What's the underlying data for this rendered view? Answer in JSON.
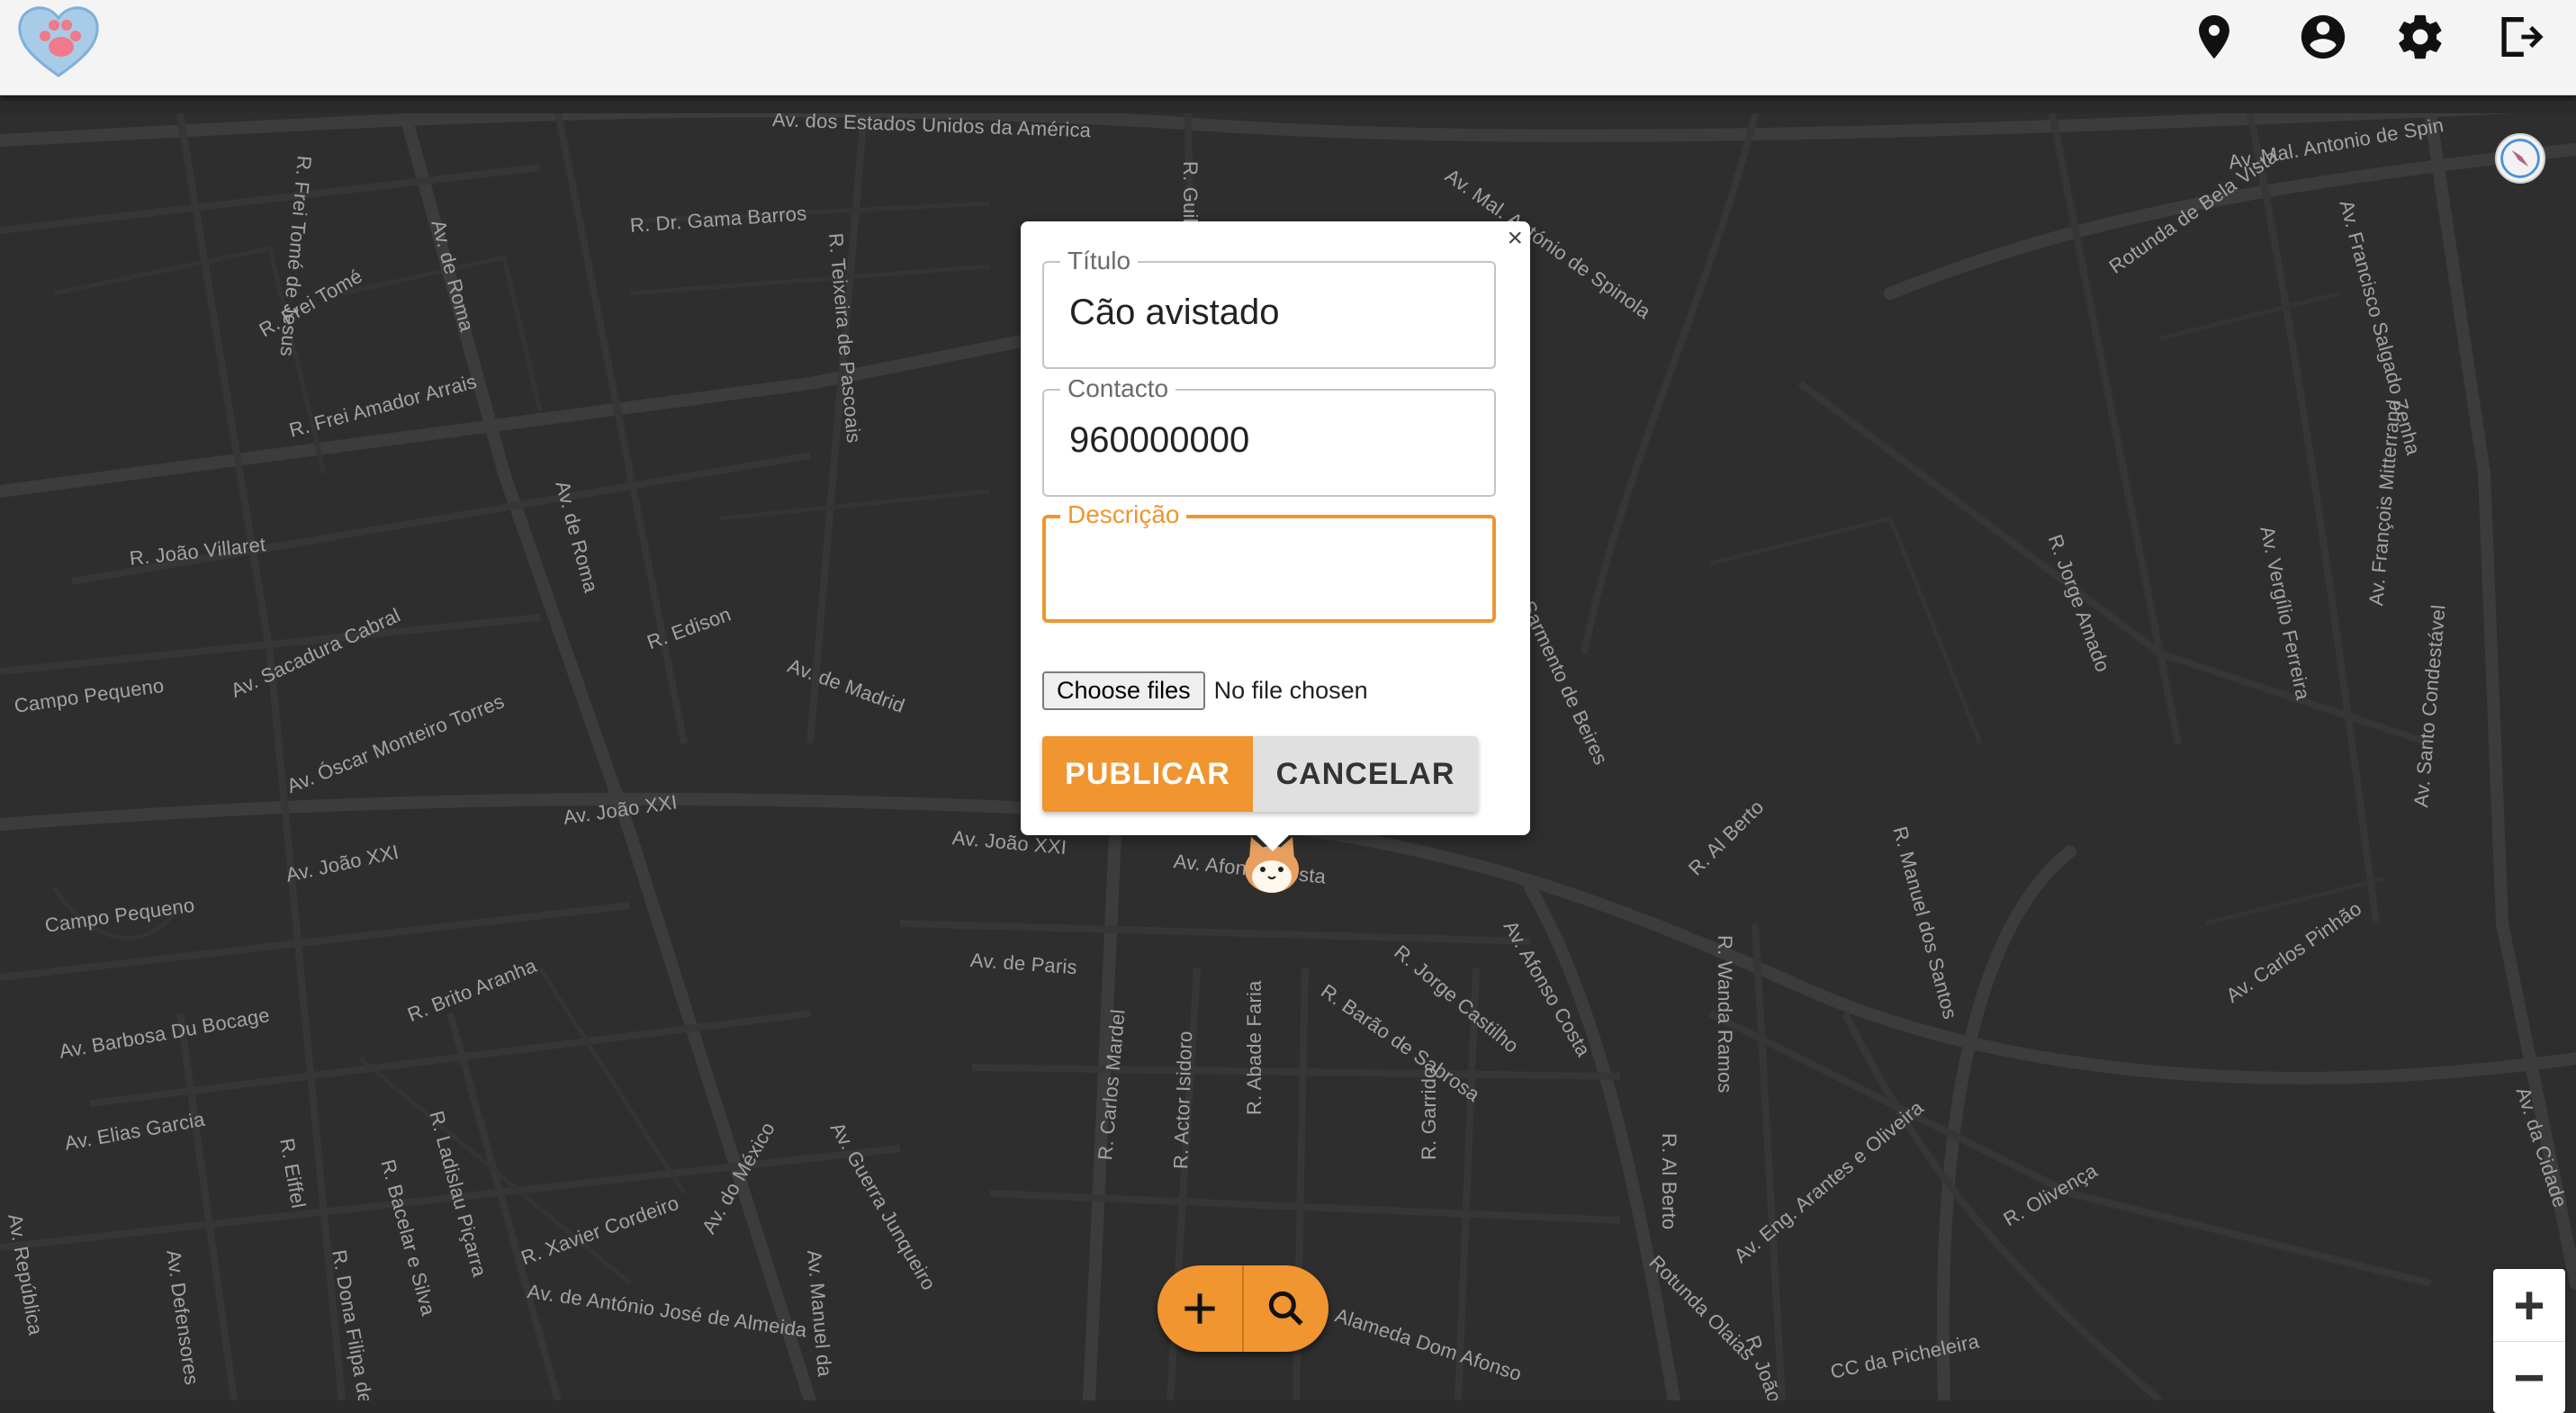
{
  "header": {
    "logo_icon": "paw-heart-logo-icon",
    "icons": [
      "location-pin-icon",
      "account-circle-icon",
      "gear-icon",
      "logout-icon"
    ]
  },
  "map": {
    "streets": [
      "Av. dos Estados Unidos da América",
      "R. Dr. Gama Barros",
      "R. Frei Tomé de Jesus",
      "Av. de Roma",
      "R. Frei Tomé",
      "R. Frei Amador Arrais",
      "R. Teixeira de Pascoais",
      "R. Guilherme",
      "Av. Mal. António de Spinola",
      "Av. Mal. Antonio de Spin",
      "Rotunda de Bela Vista",
      "Av. Francisco Salgado Zenha",
      "R. João Villaret",
      "Av. de Roma",
      "Av. Sacadura Cabral",
      "R. Edison",
      "Campo Pequeno",
      "Av. Óscar Monteiro Torres",
      "Av. de Madrid",
      "Sarmento de Beires",
      "R. Jorge Amado",
      "Av. Vergílio Ferreira",
      "Av. François Mitterrand",
      "Av. João XXI",
      "Av. João XXI",
      "Av. João XXI",
      "Av. Afonso Costa",
      "Av. Santo Condestável",
      "Campo Pequeno",
      "R. Al Berto",
      "R. Manuel dos Santos",
      "Av. Carlos Pinhão",
      "Av. de Paris",
      "R. Jorge Castilho",
      "Av. Afonso Costa",
      "R. Brito Aranha",
      "Av. Barbosa Du Bocage",
      "R. Barão de Sabrosa",
      "R. Wanda Ramos",
      "R. Ladislau Piçarra",
      "Av. Elias Garcia",
      "R. Eiffel",
      "R. Bacelar e Silva",
      "R. Carlos Mardel",
      "R. Actor Isidoro",
      "R. Abade Faria",
      "R. Garrido",
      "R. Al Berto",
      "Av. Eng. Arantes e Oliveira",
      "R. Olivença",
      "Av. República",
      "Av. Defensores",
      "R. Dona Filipa de",
      "R. Xavier Cordeiro",
      "Av. do México",
      "Av. Guerra Junqueiro",
      "Av. de António José de Almeida",
      "Av. Manuel da",
      "Alameda Dom Afonso",
      "Rotunda Olaias",
      "R. João",
      "CC da Picheleira",
      "Av. da Cidade"
    ]
  },
  "compass_icon": "compass-icon",
  "popup": {
    "close_label": "×",
    "title_label": "Título",
    "title_value": "Cão avistado",
    "contact_label": "Contacto",
    "contact_value": "960000000",
    "description_label": "Descrição",
    "description_value": "",
    "file_button_label": "Choose files",
    "file_status": "No file chosen",
    "publish_label": "PUBLICAR",
    "cancel_label": "CANCELAR"
  },
  "marker_icon": "cat-face-marker-icon",
  "fab": {
    "add_icon": "plus-icon",
    "search_icon": "search-icon"
  },
  "zoom": {
    "in_label": "+",
    "out_label": "−"
  },
  "colors": {
    "accent": "#f0952f",
    "map_background": "#2e2e2e",
    "road": "#3d3d3d",
    "topbar": "#f4f4f4"
  }
}
